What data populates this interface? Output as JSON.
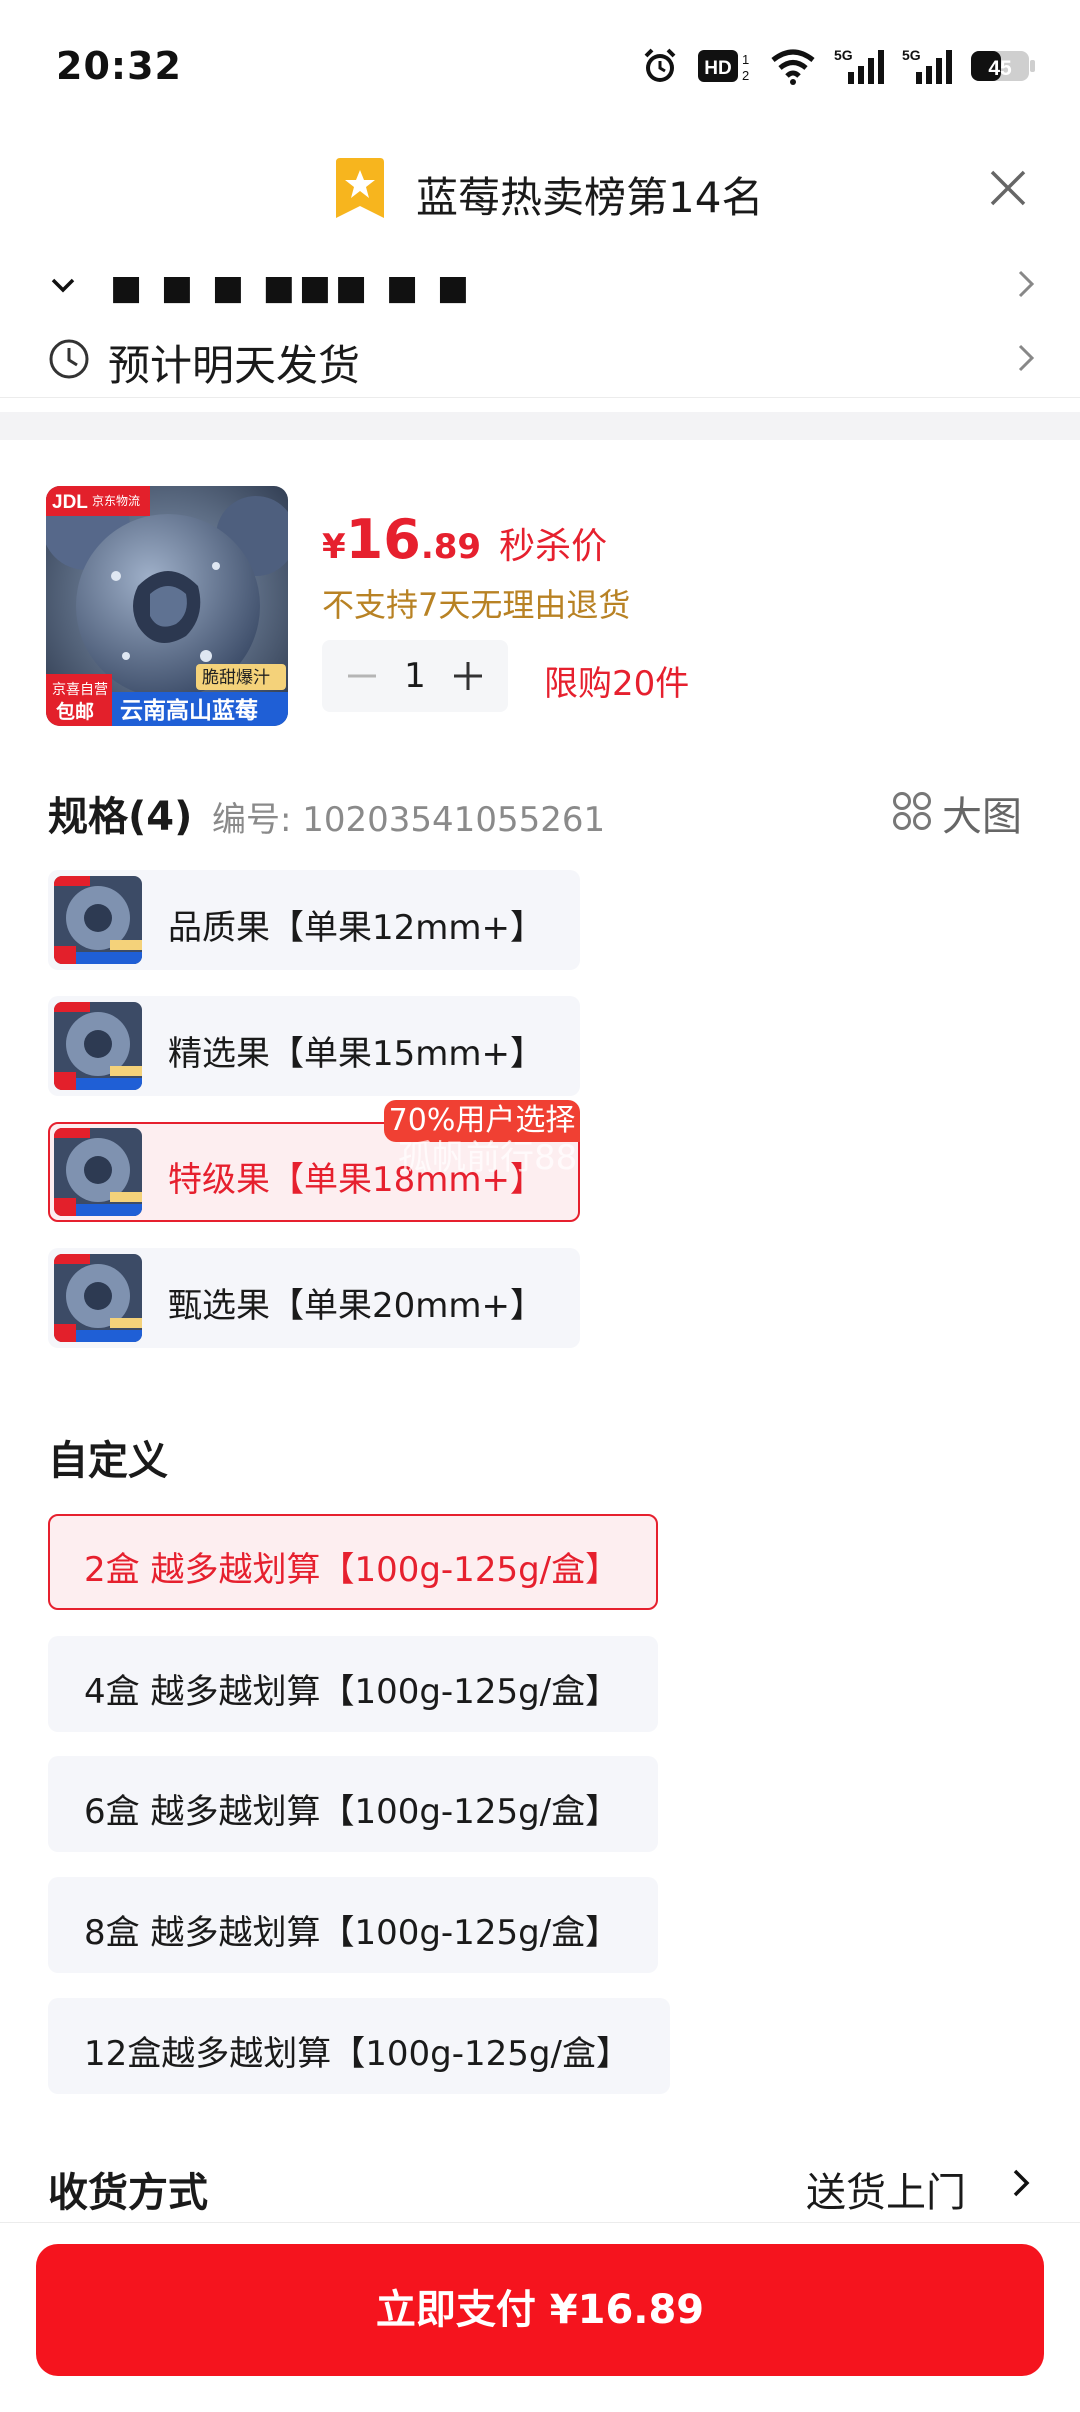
{
  "status_bar": {
    "time": "20:32",
    "hd_label": "HD",
    "net1": "5G",
    "net2": "5G",
    "battery": "45",
    "icons": [
      "alarm-icon",
      "hd-icon",
      "wifi-icon",
      "signal-5g-icon",
      "signal-5g-icon",
      "battery-icon"
    ]
  },
  "rank_banner": {
    "text": "蓝莓热卖榜第14名",
    "icon": "rank-badge-icon"
  },
  "address": {
    "text": "■ ■ ■   ■■■ ■ ■"
  },
  "shipping": {
    "text": "预计明天发货",
    "icon": "clock-icon"
  },
  "product": {
    "thumb": {
      "logo": "JDL",
      "logo_sub": "京东物流",
      "corner_top": "京喜自营",
      "corner_bottom": "包邮",
      "badge": "脆甜爆汁",
      "caption": "云南高山蓝莓"
    },
    "price_currency": "¥",
    "price_int": "16",
    "price_dec": ".89",
    "price_label": "秒杀价",
    "return_note": "不支持7天无理由退货",
    "quantity": "1",
    "limit": "限购20件"
  },
  "spec": {
    "title": "规格(4)",
    "code": "编号: 10203541055261",
    "bigpic_label": "大图",
    "tag": "70%用户选择",
    "items": [
      {
        "label": "品质果【单果12mm+】",
        "selected": false
      },
      {
        "label": "精选果【单果15mm+】",
        "selected": false
      },
      {
        "label": "特级果【单果18mm+】",
        "selected": true
      },
      {
        "label": "甄选果【单果20mm+】",
        "selected": false
      }
    ]
  },
  "custom": {
    "title": "自定义",
    "items": [
      {
        "label": "2盒 越多越划算【100g-125g/盒】",
        "selected": true
      },
      {
        "label": "4盒 越多越划算【100g-125g/盒】",
        "selected": false
      },
      {
        "label": "6盒 越多越划算【100g-125g/盒】",
        "selected": false
      },
      {
        "label": "8盒 越多越划算【100g-125g/盒】",
        "selected": false
      },
      {
        "label": "12盒越多越划算【100g-125g/盒】",
        "selected": false
      }
    ]
  },
  "delivery": {
    "title": "收货方式",
    "value": "送货上门"
  },
  "pay_button": {
    "label": "立即支付 ¥16.89"
  },
  "watermark": "孤帆前行88",
  "colors": {
    "accent": "#e6202e",
    "pay": "#f5141e",
    "note": "#b88224",
    "tag": "#f04033"
  }
}
